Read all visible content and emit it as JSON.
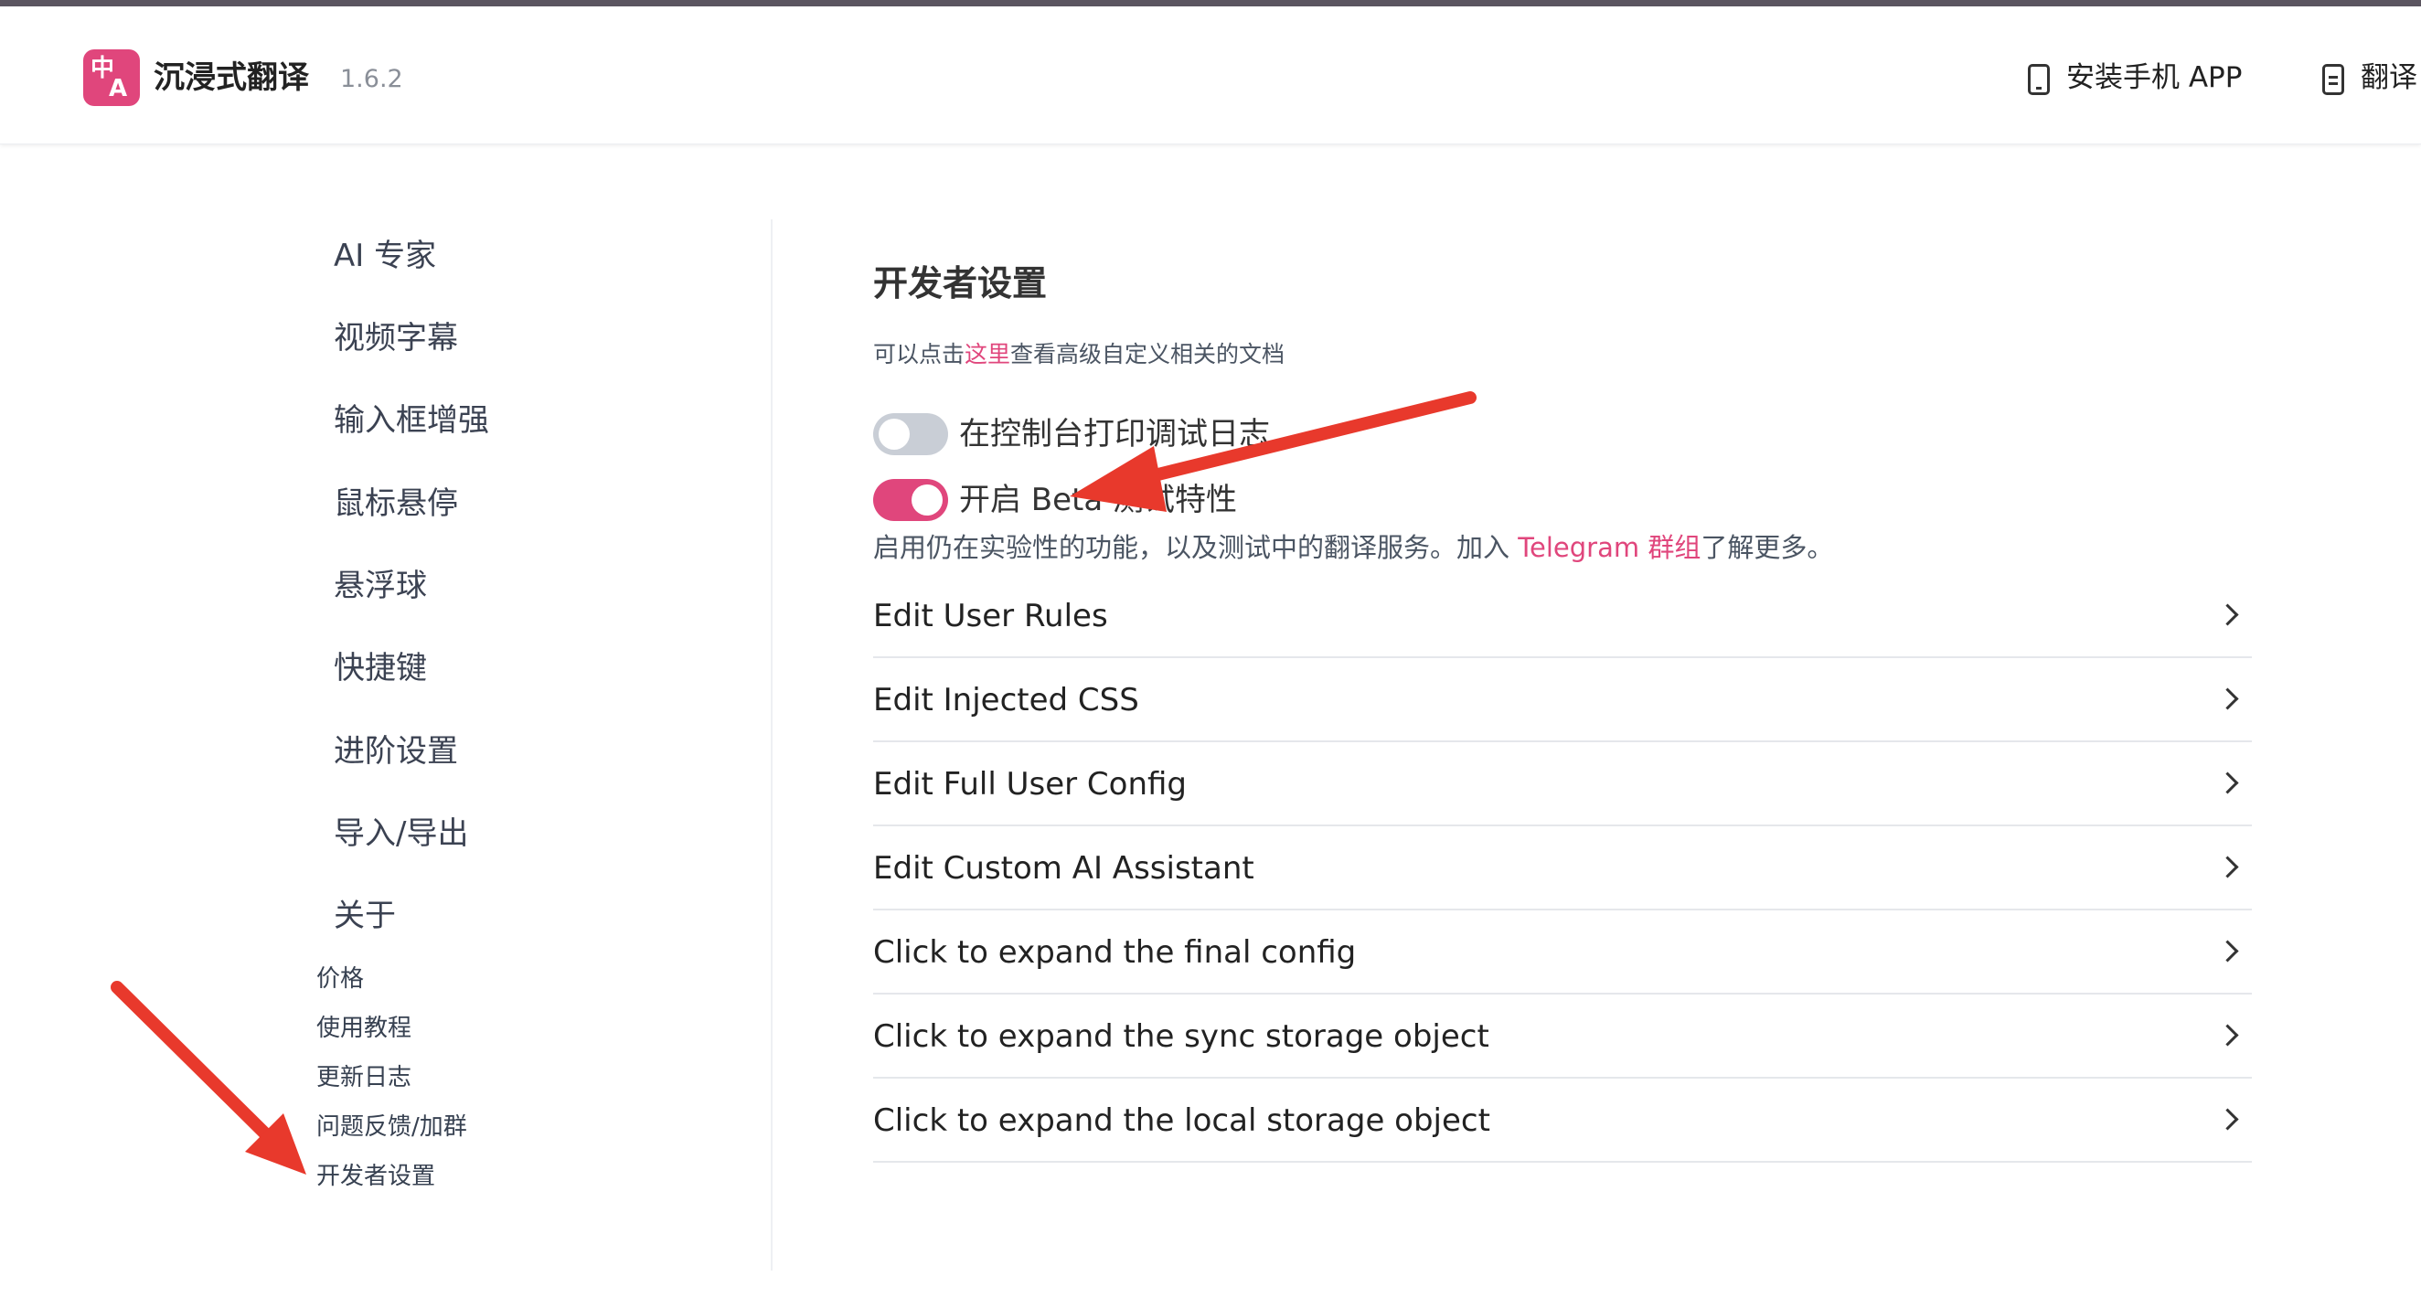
{
  "header": {
    "logo_glyph_1": "中",
    "logo_glyph_2": "A",
    "app_name": "沉浸式翻译",
    "version": "1.6.2",
    "links": [
      {
        "label": "安装手机 APP",
        "icon": "phone-icon"
      },
      {
        "label": "翻译",
        "icon": "document-icon"
      }
    ]
  },
  "sidebar": {
    "main_items": [
      "AI 专家",
      "视频字幕",
      "输入框增强",
      "鼠标悬停",
      "悬浮球",
      "快捷键",
      "进阶设置",
      "导入/导出",
      "关于"
    ],
    "sub_items": [
      "价格",
      "使用教程",
      "更新日志",
      "问题反馈/加群",
      "开发者设置"
    ],
    "active_item": "开发者设置"
  },
  "main": {
    "title": "开发者设置",
    "hint_before": "可以点击",
    "hint_link": "这里",
    "hint_after": "查看高级自定义相关的文档",
    "toggles": [
      {
        "label": "在控制台打印调试日志",
        "on": false
      },
      {
        "label": "开启 Beta 测试特性",
        "on": true
      }
    ],
    "beta_desc_before": "启用仍在实验性的功能，以及测试中的翻译服务。加入 ",
    "beta_desc_link": "Telegram 群组",
    "beta_desc_after": "了解更多。",
    "rows": [
      "Edit User Rules",
      "Edit Injected CSS",
      "Edit Full User Config",
      "Edit Custom AI Assistant",
      "Click to expand the final config",
      "Click to expand the sync storage object",
      "Click to expand the local storage object"
    ]
  },
  "colors": {
    "accent": "#e0467c",
    "annotation_arrow": "#e8392c",
    "toggle_off": "#c9ced6"
  }
}
